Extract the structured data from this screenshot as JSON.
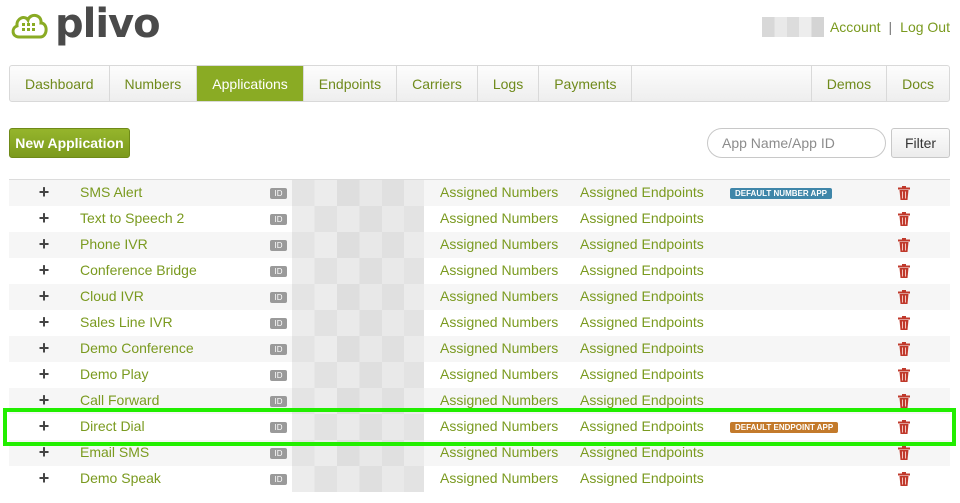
{
  "brand": {
    "name": "plivo",
    "color": "#8aab24"
  },
  "header": {
    "account_label": "Account",
    "separator": "|",
    "logout_label": "Log Out"
  },
  "nav": {
    "left": [
      "Dashboard",
      "Numbers",
      "Applications",
      "Endpoints",
      "Carriers",
      "Logs",
      "Payments"
    ],
    "right": [
      "Demos",
      "Docs"
    ],
    "active": "Applications"
  },
  "toolbar": {
    "new_button": "New Application",
    "search_placeholder": "App Name/App ID",
    "filter_button": "Filter"
  },
  "table": {
    "id_label": "ID",
    "numbers_label": "Assigned Numbers",
    "endpoints_label": "Assigned Endpoints",
    "rows": [
      {
        "name": "SMS Alert",
        "badge": "DEFAULT NUMBER APP",
        "badge_type": "number"
      },
      {
        "name": "Text to Speech 2"
      },
      {
        "name": "Phone IVR"
      },
      {
        "name": "Conference Bridge"
      },
      {
        "name": "Cloud IVR"
      },
      {
        "name": "Sales Line IVR"
      },
      {
        "name": "Demo Conference"
      },
      {
        "name": "Demo Play"
      },
      {
        "name": "Call Forward"
      },
      {
        "name": "Direct Dial",
        "badge": "DEFAULT ENDPOINT APP",
        "badge_type": "endpoint",
        "highlighted": true
      },
      {
        "name": "Email SMS"
      },
      {
        "name": "Demo Speak"
      }
    ]
  },
  "icons": {
    "row_expand": "plus-icon",
    "row_delete": "trash-icon",
    "logo": "cloud-grid-icon"
  },
  "colors": {
    "link": "#7a9a1f",
    "active_tab": "#8aab24",
    "number_badge": "#3f86a9",
    "endpoint_badge": "#c37a2b",
    "delete": "#c0392b",
    "highlight": "#22ee00"
  }
}
